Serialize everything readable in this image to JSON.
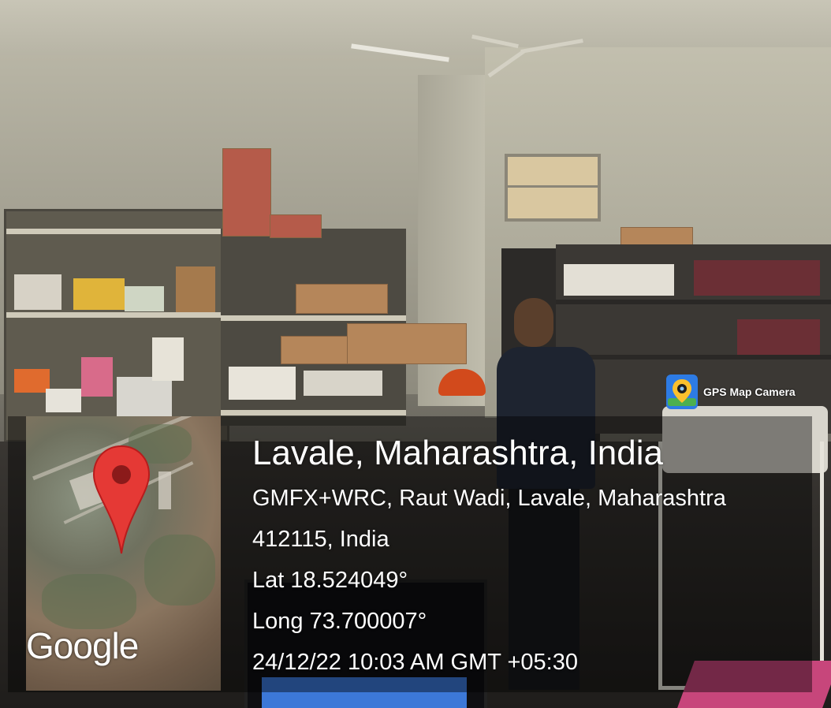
{
  "location": {
    "title": "Lavale, Maharashtra, India",
    "address_line1": "GMFX+WRC, Raut Wadi, Lavale, Maharashtra",
    "address_line2": "412115, India",
    "latitude": "Lat 18.524049°",
    "longitude": "Long 73.700007°",
    "datetime": "24/12/22 10:03 AM GMT +05:30"
  },
  "brand": {
    "label": "GPS Map Camera",
    "icon": "map-pin-camera-icon"
  },
  "map": {
    "attribution": "Google",
    "pin_icon": "map-pin-icon",
    "pin_color": "#e53935"
  },
  "colors": {
    "overlay": "rgba(0,0,0,0.42)",
    "brand_icon_bg": "#2d7be4"
  }
}
